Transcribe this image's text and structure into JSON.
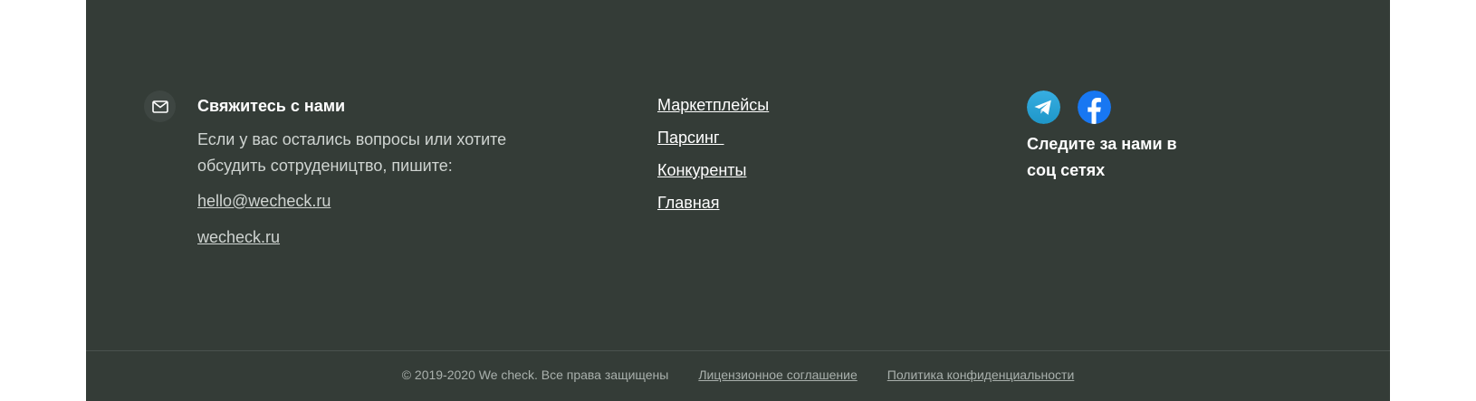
{
  "contact": {
    "title": "Свяжитесь с нами",
    "text": "Если у вас остались вопросы или хотите обсудить сотрудеництво, пишите:",
    "email": "hello@wecheck.ru",
    "site": "wecheck.ru",
    "icon": "mail-icon"
  },
  "nav": {
    "items": [
      {
        "label": "Маркетплейсы"
      },
      {
        "label": "Парсинг "
      },
      {
        "label": "Конкуренты"
      },
      {
        "label": "Главная"
      }
    ]
  },
  "social": {
    "icons": [
      "telegram-icon",
      "facebook-icon"
    ],
    "caption": "Следите за нами в соц сетях",
    "telegram_color": "#2ca5e0",
    "facebook_color": "#1877f2"
  },
  "bottom": {
    "copyright": "© 2019-2020 We check. Все права защищены",
    "license": "Лицензионное соглашение",
    "privacy": "Политика конфиденциальности"
  },
  "colors": {
    "footer_bg": "#343c37",
    "text_muted": "#cfd4d1"
  }
}
